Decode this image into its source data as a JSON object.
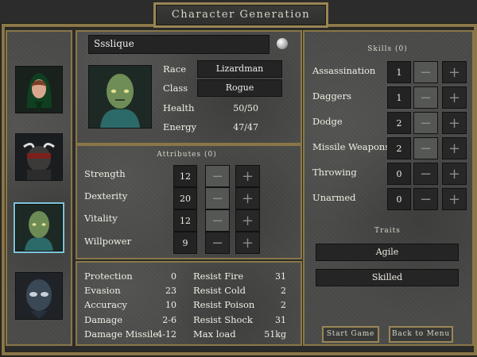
{
  "window_title": "Character Generation",
  "character": {
    "name": "Ssslique",
    "race_label": "Race",
    "race_value": "Lizardman",
    "class_label": "Class",
    "class_value": "Rogue",
    "health_label": "Health",
    "health_value": "50/50",
    "energy_label": "Energy",
    "energy_value": "47/47"
  },
  "attributes": {
    "header": "Attributes (0)",
    "items": [
      {
        "label": "Strength",
        "value": "12"
      },
      {
        "label": "Dexterity",
        "value": "20"
      },
      {
        "label": "Vitality",
        "value": "12"
      },
      {
        "label": "Willpower",
        "value": "9"
      }
    ]
  },
  "stats": {
    "left": [
      {
        "label": "Protection",
        "value": "0"
      },
      {
        "label": "Evasion",
        "value": "23"
      },
      {
        "label": "Accuracy",
        "value": "10"
      },
      {
        "label": "Damage",
        "value": "2-6"
      },
      {
        "label": "Damage Missile",
        "value": "4-12"
      }
    ],
    "right": [
      {
        "label": "Resist Fire",
        "value": "31"
      },
      {
        "label": "Resist Cold",
        "value": "2"
      },
      {
        "label": "Resist Poison",
        "value": "2"
      },
      {
        "label": "Resist Shock",
        "value": "31"
      },
      {
        "label": "Max load",
        "value": "51kg"
      }
    ]
  },
  "skills": {
    "header": "Skills (0)",
    "items": [
      {
        "label": "Assassination",
        "value": "1"
      },
      {
        "label": "Daggers",
        "value": "1"
      },
      {
        "label": "Dodge",
        "value": "2"
      },
      {
        "label": "Missile Weapons",
        "value": "2"
      },
      {
        "label": "Throwing",
        "value": "0"
      },
      {
        "label": "Unarmed",
        "value": "0"
      }
    ]
  },
  "traits": {
    "header": "Traits",
    "items": [
      "Agile",
      "Skilled"
    ]
  },
  "buttons": {
    "start": "Start Game",
    "back": "Back to Menu"
  },
  "icons": {
    "randomize": "globe-icon",
    "minus": "minus-icon",
    "plus": "plus-icon"
  },
  "colors": {
    "frame": "#9a8656",
    "selection": "#7dc3d6",
    "panel": "#4a4b49"
  }
}
